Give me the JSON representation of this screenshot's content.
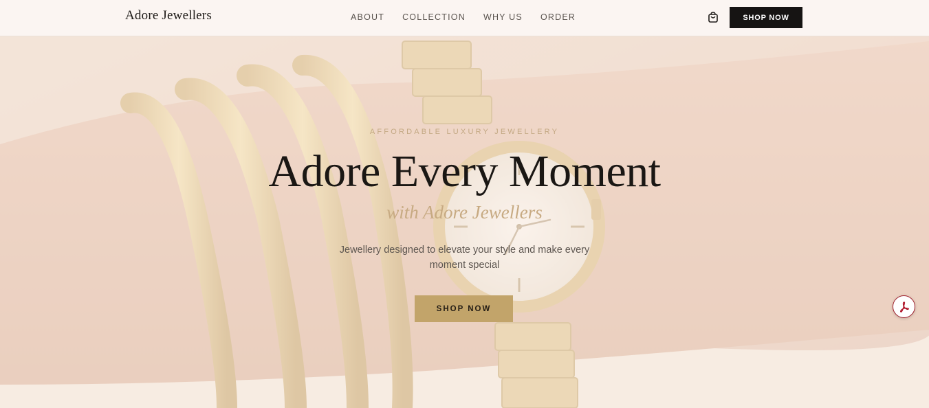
{
  "nav": {
    "brand": "Adore Jewellers",
    "links": [
      "ABOUT",
      "COLLECTION",
      "WHY US",
      "ORDER"
    ],
    "cart_icon": "shopping-bag-icon",
    "cta_label": "SHOP NOW"
  },
  "hero": {
    "eyebrow": "AFFORDABLE LUXURY JEWELLERY",
    "headline": "Adore Every Moment",
    "subheadline": "with Adore Jewellers",
    "description": "Jewellery designed to elevate your style and make every moment special",
    "cta_label": "SHOP NOW",
    "background_image": "gold-bangles-and-wristwatch"
  },
  "widget": {
    "icon": "acrobat-pdf-icon"
  },
  "colors": {
    "accent_gold": "#c2a46a",
    "dark": "#161413",
    "eyebrow": "#c3a883",
    "subheadline": "#c7aa82"
  }
}
